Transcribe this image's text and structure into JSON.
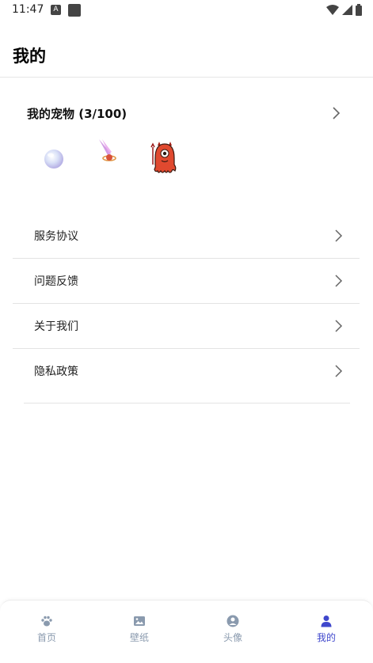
{
  "status": {
    "time": "11:47",
    "a_icon": "A"
  },
  "header": {
    "title": "我的"
  },
  "pets": {
    "title": "我的宠物 (3/100)"
  },
  "menu": {
    "items": [
      {
        "label": "服务协议"
      },
      {
        "label": "问题反馈"
      },
      {
        "label": "关于我们"
      },
      {
        "label": "隐私政策"
      }
    ]
  },
  "nav": {
    "items": [
      {
        "label": "首页",
        "icon": "paw-icon"
      },
      {
        "label": "壁纸",
        "icon": "image-icon"
      },
      {
        "label": "头像",
        "icon": "user-circle-icon"
      },
      {
        "label": "我的",
        "icon": "person-icon"
      }
    ],
    "colors": {
      "inactive": "#8a9aae",
      "active": "#3f47cc"
    }
  }
}
